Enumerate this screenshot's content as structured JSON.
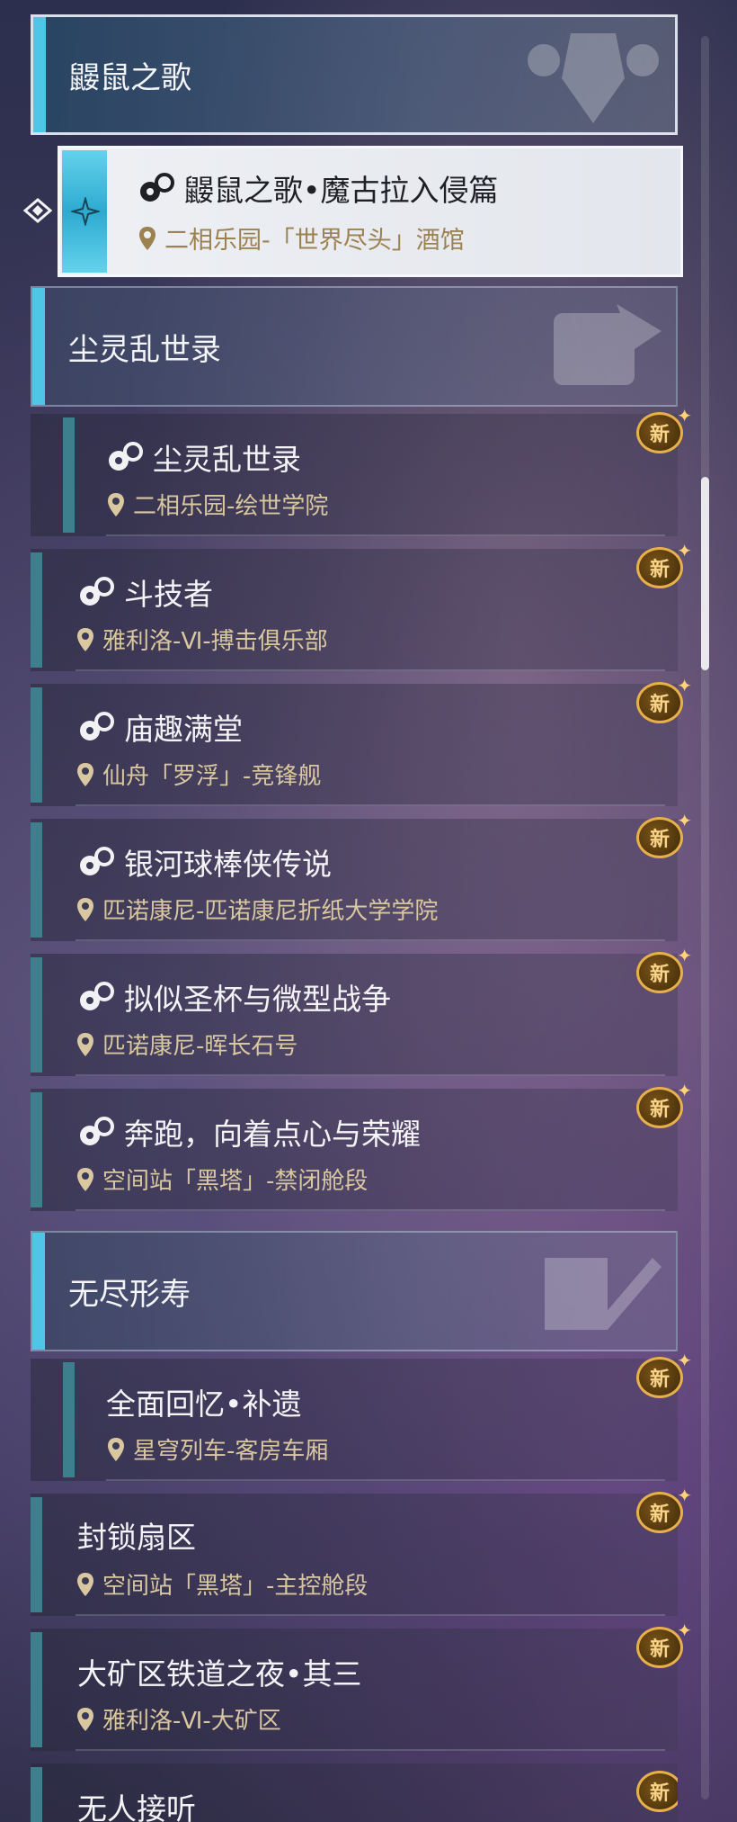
{
  "new_badge_label": "新",
  "categories": [
    {
      "title": "鼹鼠之歌",
      "selected": true
    },
    {
      "title": "尘灵乱世录"
    },
    {
      "title": "无尽形寿"
    }
  ],
  "selected_item": {
    "title": "鼹鼠之歌•魔古拉入侵篇",
    "location": "二相乐园-「世界尽头」酒馆"
  },
  "items": [
    {
      "title": "尘灵乱世录",
      "location": "二相乐园-绘世学院"
    },
    {
      "title": "斗技者",
      "location": "雅利洛-Ⅵ-搏击俱乐部"
    },
    {
      "title": "庙趣满堂",
      "location": "仙舟「罗浮」-竞锋舰"
    },
    {
      "title": "银河球棒侠传说",
      "location": "匹诺康尼-匹诺康尼折纸大学学院"
    },
    {
      "title": "拟似圣杯与微型战争",
      "location": "匹诺康尼-晖长石号"
    },
    {
      "title": "奔跑，向着点心与荣耀",
      "location": "空间站「黑塔」-禁闭舱段"
    },
    {
      "title": "全面回忆•补遗",
      "location": "星穹列车-客房车厢"
    },
    {
      "title": "封锁扇区",
      "location": "空间站「黑塔」-主控舱段"
    },
    {
      "title": "大矿区铁道之夜•其三",
      "location": "雅利洛-Ⅵ-大矿区"
    },
    {
      "title": "无人接听",
      "location": ""
    }
  ],
  "colors": {
    "accent": "#4fc6e6",
    "location_text": "#d9c7a0",
    "badge": "#e8b04a"
  }
}
